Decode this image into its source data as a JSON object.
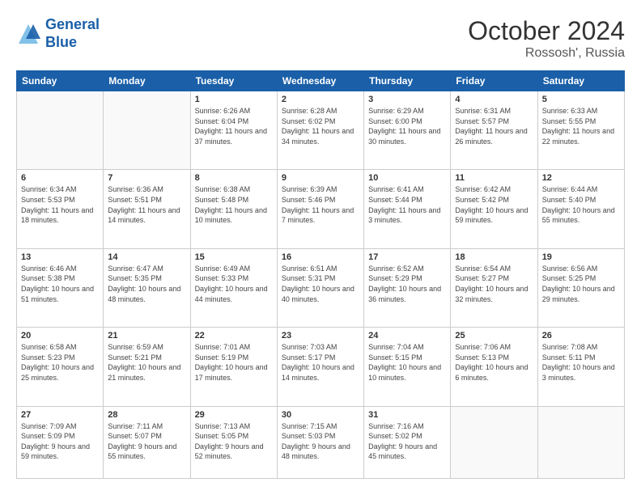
{
  "header": {
    "logo_line1": "General",
    "logo_line2": "Blue",
    "month": "October 2024",
    "location": "Rossosh', Russia"
  },
  "days_of_week": [
    "Sunday",
    "Monday",
    "Tuesday",
    "Wednesday",
    "Thursday",
    "Friday",
    "Saturday"
  ],
  "weeks": [
    [
      {
        "day": "",
        "sunrise": "",
        "sunset": "",
        "daylight": ""
      },
      {
        "day": "",
        "sunrise": "",
        "sunset": "",
        "daylight": ""
      },
      {
        "day": "1",
        "sunrise": "Sunrise: 6:26 AM",
        "sunset": "Sunset: 6:04 PM",
        "daylight": "Daylight: 11 hours and 37 minutes."
      },
      {
        "day": "2",
        "sunrise": "Sunrise: 6:28 AM",
        "sunset": "Sunset: 6:02 PM",
        "daylight": "Daylight: 11 hours and 34 minutes."
      },
      {
        "day": "3",
        "sunrise": "Sunrise: 6:29 AM",
        "sunset": "Sunset: 6:00 PM",
        "daylight": "Daylight: 11 hours and 30 minutes."
      },
      {
        "day": "4",
        "sunrise": "Sunrise: 6:31 AM",
        "sunset": "Sunset: 5:57 PM",
        "daylight": "Daylight: 11 hours and 26 minutes."
      },
      {
        "day": "5",
        "sunrise": "Sunrise: 6:33 AM",
        "sunset": "Sunset: 5:55 PM",
        "daylight": "Daylight: 11 hours and 22 minutes."
      }
    ],
    [
      {
        "day": "6",
        "sunrise": "Sunrise: 6:34 AM",
        "sunset": "Sunset: 5:53 PM",
        "daylight": "Daylight: 11 hours and 18 minutes."
      },
      {
        "day": "7",
        "sunrise": "Sunrise: 6:36 AM",
        "sunset": "Sunset: 5:51 PM",
        "daylight": "Daylight: 11 hours and 14 minutes."
      },
      {
        "day": "8",
        "sunrise": "Sunrise: 6:38 AM",
        "sunset": "Sunset: 5:48 PM",
        "daylight": "Daylight: 11 hours and 10 minutes."
      },
      {
        "day": "9",
        "sunrise": "Sunrise: 6:39 AM",
        "sunset": "Sunset: 5:46 PM",
        "daylight": "Daylight: 11 hours and 7 minutes."
      },
      {
        "day": "10",
        "sunrise": "Sunrise: 6:41 AM",
        "sunset": "Sunset: 5:44 PM",
        "daylight": "Daylight: 11 hours and 3 minutes."
      },
      {
        "day": "11",
        "sunrise": "Sunrise: 6:42 AM",
        "sunset": "Sunset: 5:42 PM",
        "daylight": "Daylight: 10 hours and 59 minutes."
      },
      {
        "day": "12",
        "sunrise": "Sunrise: 6:44 AM",
        "sunset": "Sunset: 5:40 PM",
        "daylight": "Daylight: 10 hours and 55 minutes."
      }
    ],
    [
      {
        "day": "13",
        "sunrise": "Sunrise: 6:46 AM",
        "sunset": "Sunset: 5:38 PM",
        "daylight": "Daylight: 10 hours and 51 minutes."
      },
      {
        "day": "14",
        "sunrise": "Sunrise: 6:47 AM",
        "sunset": "Sunset: 5:35 PM",
        "daylight": "Daylight: 10 hours and 48 minutes."
      },
      {
        "day": "15",
        "sunrise": "Sunrise: 6:49 AM",
        "sunset": "Sunset: 5:33 PM",
        "daylight": "Daylight: 10 hours and 44 minutes."
      },
      {
        "day": "16",
        "sunrise": "Sunrise: 6:51 AM",
        "sunset": "Sunset: 5:31 PM",
        "daylight": "Daylight: 10 hours and 40 minutes."
      },
      {
        "day": "17",
        "sunrise": "Sunrise: 6:52 AM",
        "sunset": "Sunset: 5:29 PM",
        "daylight": "Daylight: 10 hours and 36 minutes."
      },
      {
        "day": "18",
        "sunrise": "Sunrise: 6:54 AM",
        "sunset": "Sunset: 5:27 PM",
        "daylight": "Daylight: 10 hours and 32 minutes."
      },
      {
        "day": "19",
        "sunrise": "Sunrise: 6:56 AM",
        "sunset": "Sunset: 5:25 PM",
        "daylight": "Daylight: 10 hours and 29 minutes."
      }
    ],
    [
      {
        "day": "20",
        "sunrise": "Sunrise: 6:58 AM",
        "sunset": "Sunset: 5:23 PM",
        "daylight": "Daylight: 10 hours and 25 minutes."
      },
      {
        "day": "21",
        "sunrise": "Sunrise: 6:59 AM",
        "sunset": "Sunset: 5:21 PM",
        "daylight": "Daylight: 10 hours and 21 minutes."
      },
      {
        "day": "22",
        "sunrise": "Sunrise: 7:01 AM",
        "sunset": "Sunset: 5:19 PM",
        "daylight": "Daylight: 10 hours and 17 minutes."
      },
      {
        "day": "23",
        "sunrise": "Sunrise: 7:03 AM",
        "sunset": "Sunset: 5:17 PM",
        "daylight": "Daylight: 10 hours and 14 minutes."
      },
      {
        "day": "24",
        "sunrise": "Sunrise: 7:04 AM",
        "sunset": "Sunset: 5:15 PM",
        "daylight": "Daylight: 10 hours and 10 minutes."
      },
      {
        "day": "25",
        "sunrise": "Sunrise: 7:06 AM",
        "sunset": "Sunset: 5:13 PM",
        "daylight": "Daylight: 10 hours and 6 minutes."
      },
      {
        "day": "26",
        "sunrise": "Sunrise: 7:08 AM",
        "sunset": "Sunset: 5:11 PM",
        "daylight": "Daylight: 10 hours and 3 minutes."
      }
    ],
    [
      {
        "day": "27",
        "sunrise": "Sunrise: 7:09 AM",
        "sunset": "Sunset: 5:09 PM",
        "daylight": "Daylight: 9 hours and 59 minutes."
      },
      {
        "day": "28",
        "sunrise": "Sunrise: 7:11 AM",
        "sunset": "Sunset: 5:07 PM",
        "daylight": "Daylight: 9 hours and 55 minutes."
      },
      {
        "day": "29",
        "sunrise": "Sunrise: 7:13 AM",
        "sunset": "Sunset: 5:05 PM",
        "daylight": "Daylight: 9 hours and 52 minutes."
      },
      {
        "day": "30",
        "sunrise": "Sunrise: 7:15 AM",
        "sunset": "Sunset: 5:03 PM",
        "daylight": "Daylight: 9 hours and 48 minutes."
      },
      {
        "day": "31",
        "sunrise": "Sunrise: 7:16 AM",
        "sunset": "Sunset: 5:02 PM",
        "daylight": "Daylight: 9 hours and 45 minutes."
      },
      {
        "day": "",
        "sunrise": "",
        "sunset": "",
        "daylight": ""
      },
      {
        "day": "",
        "sunrise": "",
        "sunset": "",
        "daylight": ""
      }
    ]
  ]
}
